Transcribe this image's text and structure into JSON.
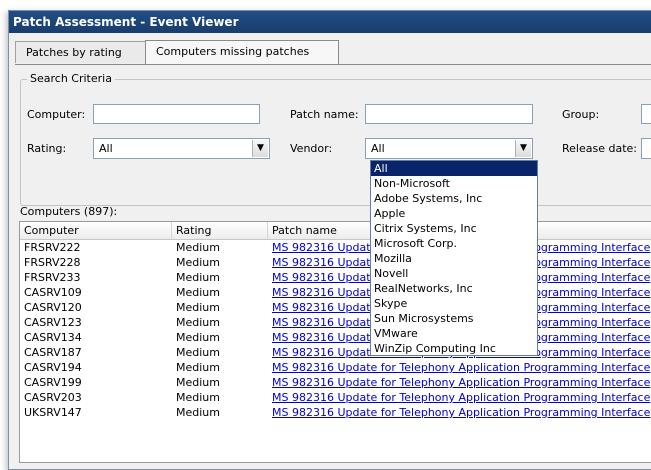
{
  "window": {
    "title": "Patch Assessment - Event Viewer"
  },
  "tabs": [
    {
      "label": "Patches by rating",
      "active": false
    },
    {
      "label": "Computers missing patches",
      "active": true
    }
  ],
  "search_criteria": {
    "legend": "Search Criteria",
    "computer_label": "Computer:",
    "computer_value": "",
    "patch_name_label": "Patch name:",
    "patch_name_value": "",
    "group_label": "Group:",
    "rating_label": "Rating:",
    "rating_value": "All",
    "vendor_label": "Vendor:",
    "vendor_value": "All",
    "release_date_label": "Release date:"
  },
  "vendor_dropdown": {
    "options": [
      "All",
      "Non-Microsoft",
      "Adobe Systems, Inc",
      "Apple",
      "Citrix Systems, Inc",
      "Microsoft Corp.",
      "Mozilla",
      "Novell",
      "RealNetworks, Inc",
      "Skype",
      "Sun Microsystems",
      "VMware",
      "WinZip Computing Inc"
    ],
    "selected": "All"
  },
  "computers": {
    "count_label": "Computers (897):",
    "columns": [
      "Computer",
      "Rating",
      "Patch name"
    ],
    "rows": [
      {
        "computer": "FRSRV222",
        "rating": "Medium",
        "patch": "MS 982316 Update for Telephony Application Programming Interface"
      },
      {
        "computer": "FRSRV228",
        "rating": "Medium",
        "patch": "MS 982316 Update for Telephony Application Programming Interface"
      },
      {
        "computer": "FRSRV233",
        "rating": "Medium",
        "patch": "MS 982316 Update for Telephony Application Programming Interface"
      },
      {
        "computer": "CASRV109",
        "rating": "Medium",
        "patch": "MS 982316 Update for Telephony Application Programming Interface"
      },
      {
        "computer": "CASRV120",
        "rating": "Medium",
        "patch": "MS 982316 Update for Telephony Application Programming Interface"
      },
      {
        "computer": "CASRV123",
        "rating": "Medium",
        "patch": "MS 982316 Update for Telephony Application Programming Interface"
      },
      {
        "computer": "CASRV134",
        "rating": "Medium",
        "patch": "MS 982316 Update for Telephony Application Programming Interface"
      },
      {
        "computer": "CASRV187",
        "rating": "Medium",
        "patch": "MS 982316 Update for Telephony Application Programming Interface"
      },
      {
        "computer": "CASRV194",
        "rating": "Medium",
        "patch": "MS 982316 Update for Telephony Application Programming Interface"
      },
      {
        "computer": "CASRV199",
        "rating": "Medium",
        "patch": "MS 982316 Update for Telephony Application Programming Interface"
      },
      {
        "computer": "CASRV203",
        "rating": "Medium",
        "patch": "MS 982316 Update for Telephony Application Programming Interface"
      },
      {
        "computer": "UKSRV147",
        "rating": "Medium",
        "patch": "MS 982316 Update for Telephony Application Programming Interface"
      }
    ]
  }
}
